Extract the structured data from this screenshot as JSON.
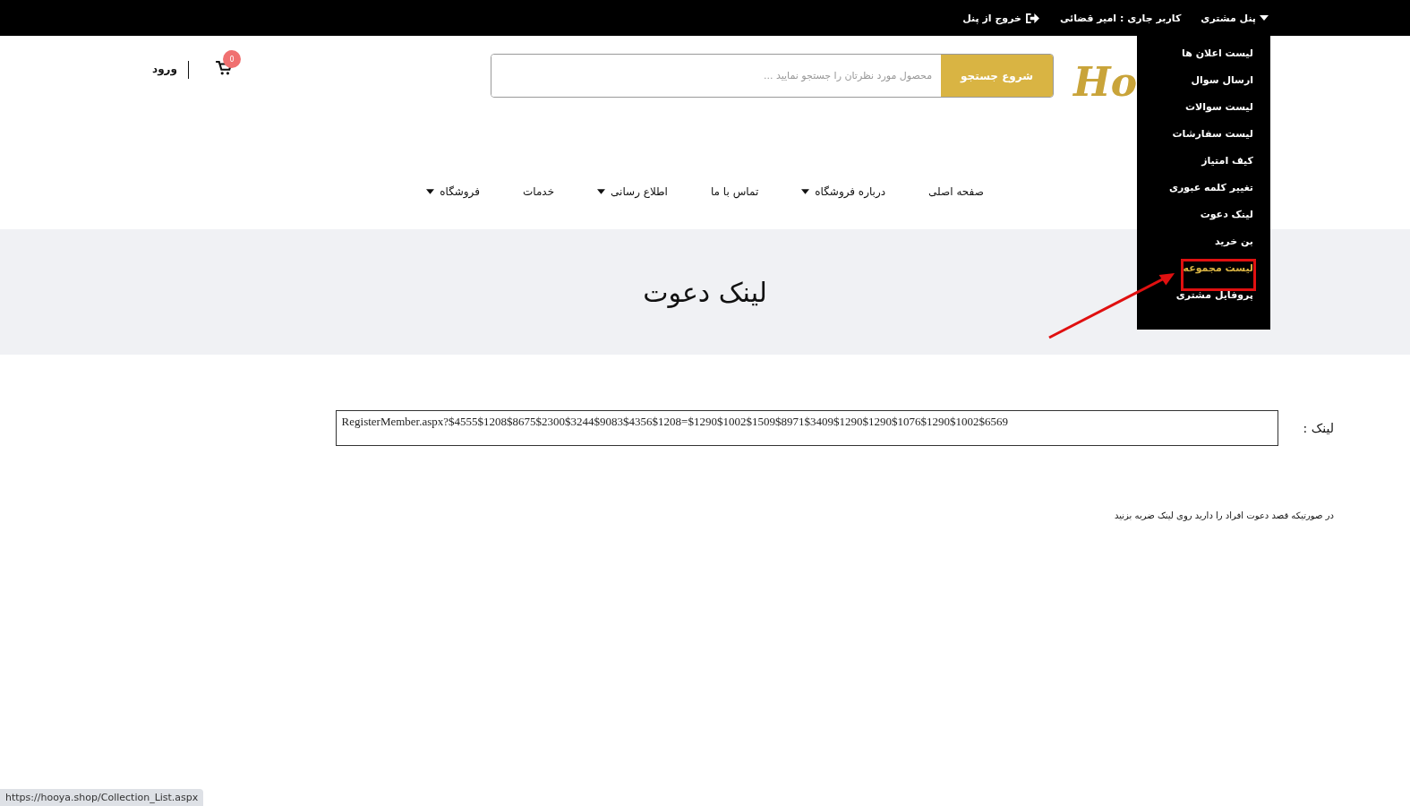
{
  "top_bar": {
    "panel_menu": "پنل مشتری",
    "current_user": "کاربر جاری : امیر قضائی",
    "logout": "خروج از پنل"
  },
  "panel_dropdown": [
    {
      "label": "لیست اعلان ها",
      "selected": false
    },
    {
      "label": "ارسال سوال",
      "selected": false
    },
    {
      "label": "لیست سوالات",
      "selected": false
    },
    {
      "label": "لیست سفارشات",
      "selected": false
    },
    {
      "label": "کیف امتیاز",
      "selected": false
    },
    {
      "label": "تغییر کلمه عبوری",
      "selected": false
    },
    {
      "label": "لینک دعوت",
      "selected": false
    },
    {
      "label": "بن خرید",
      "selected": false
    },
    {
      "label": "لیست مجموعه",
      "selected": true
    },
    {
      "label": "پروفایل مشتری",
      "selected": false
    }
  ],
  "header": {
    "logo": "Ho",
    "search": {
      "placeholder": "محصول مورد نظرتان را جستجو نمایید ...",
      "button": "شروع جستجو"
    },
    "cart_count": "0",
    "login": "ورود"
  },
  "nav": [
    {
      "label": "صفحه اصلی",
      "has_dropdown": false
    },
    {
      "label": "درباره فروشگاه",
      "has_dropdown": true
    },
    {
      "label": "تماس با ما",
      "has_dropdown": false
    },
    {
      "label": "اطلاع رسانی",
      "has_dropdown": true
    },
    {
      "label": "خدمات",
      "has_dropdown": false
    },
    {
      "label": "فروشگاه",
      "has_dropdown": true
    }
  ],
  "page_title": "لینک دعوت",
  "link_field": {
    "label": "لینک :",
    "value": "RegisterMember.aspx?$4555$1208$8675$2300$3244$9083$4356$1208=$1290$1002$1509$8971$3409$1290$1290$1076$1290$1002$6569"
  },
  "note": "در صورتیکه قصد دعوت افراد را دارید روی لینک ضربه بزنید",
  "status_url": "https://hooya.shop/Collection_List.aspx"
}
